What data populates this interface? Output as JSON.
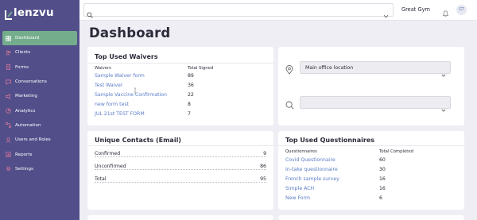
{
  "app": {
    "logo_text": "lenzvu"
  },
  "sidebar": {
    "items": [
      {
        "label": "Dashboard",
        "icon": "grid-icon",
        "active": true
      },
      {
        "label": "Clients",
        "icon": "users-icon"
      },
      {
        "label": "Forms",
        "icon": "document-icon"
      },
      {
        "label": "Conversations",
        "icon": "chat-icon"
      },
      {
        "label": "Marketing",
        "icon": "megaphone-icon"
      },
      {
        "label": "Analytics",
        "icon": "chart-icon"
      },
      {
        "label": "Automation",
        "icon": "automation-icon"
      },
      {
        "label": "Users and Roles",
        "icon": "user-roles-icon"
      },
      {
        "label": "Reports",
        "icon": "report-icon"
      },
      {
        "label": "Settings",
        "icon": "gear-icon"
      }
    ]
  },
  "topbar": {
    "search_placeholder": "",
    "org_name": "Great Gym",
    "avatar_initials": "GT"
  },
  "page": {
    "title": "Dashboard"
  },
  "waivers": {
    "title": "Top Used Waivers",
    "col_name": "Waivers",
    "col_count": "Total Signed",
    "rows": [
      {
        "name": "Sample Waiver form",
        "count": "89"
      },
      {
        "name": "Test Waiver",
        "count": "36"
      },
      {
        "name": "Sample Vaccine Confirmation",
        "count": "22"
      },
      {
        "name": "new form test",
        "count": "8"
      },
      {
        "name": "JUL 21st TEST FORM",
        "count": "7"
      }
    ]
  },
  "location": {
    "location_select": "Main office location",
    "search_select": ""
  },
  "contacts": {
    "title": "Unique Contacts (Email)",
    "rows": [
      {
        "label": "Confirmed",
        "value": "9"
      },
      {
        "label": "Unconfirmed",
        "value": "86"
      },
      {
        "label": "Total",
        "value": "95"
      }
    ]
  },
  "questionnaires": {
    "title": "Top Used Questionnaires",
    "col_name": "Questionnaires",
    "col_count": "Total Completed",
    "rows": [
      {
        "name": "Covid Questionnaire",
        "count": "60"
      },
      {
        "name": "In-take questionnaire",
        "count": "30"
      },
      {
        "name": "French sample survey",
        "count": "16"
      },
      {
        "name": "Simple ACH",
        "count": "16"
      },
      {
        "name": "New Form",
        "count": "6"
      }
    ]
  },
  "colors": {
    "sidebar_bg": "#524e8a",
    "active_item": "#74ad8c",
    "link": "#5b7cc8",
    "page_bg": "#eeeef4"
  }
}
